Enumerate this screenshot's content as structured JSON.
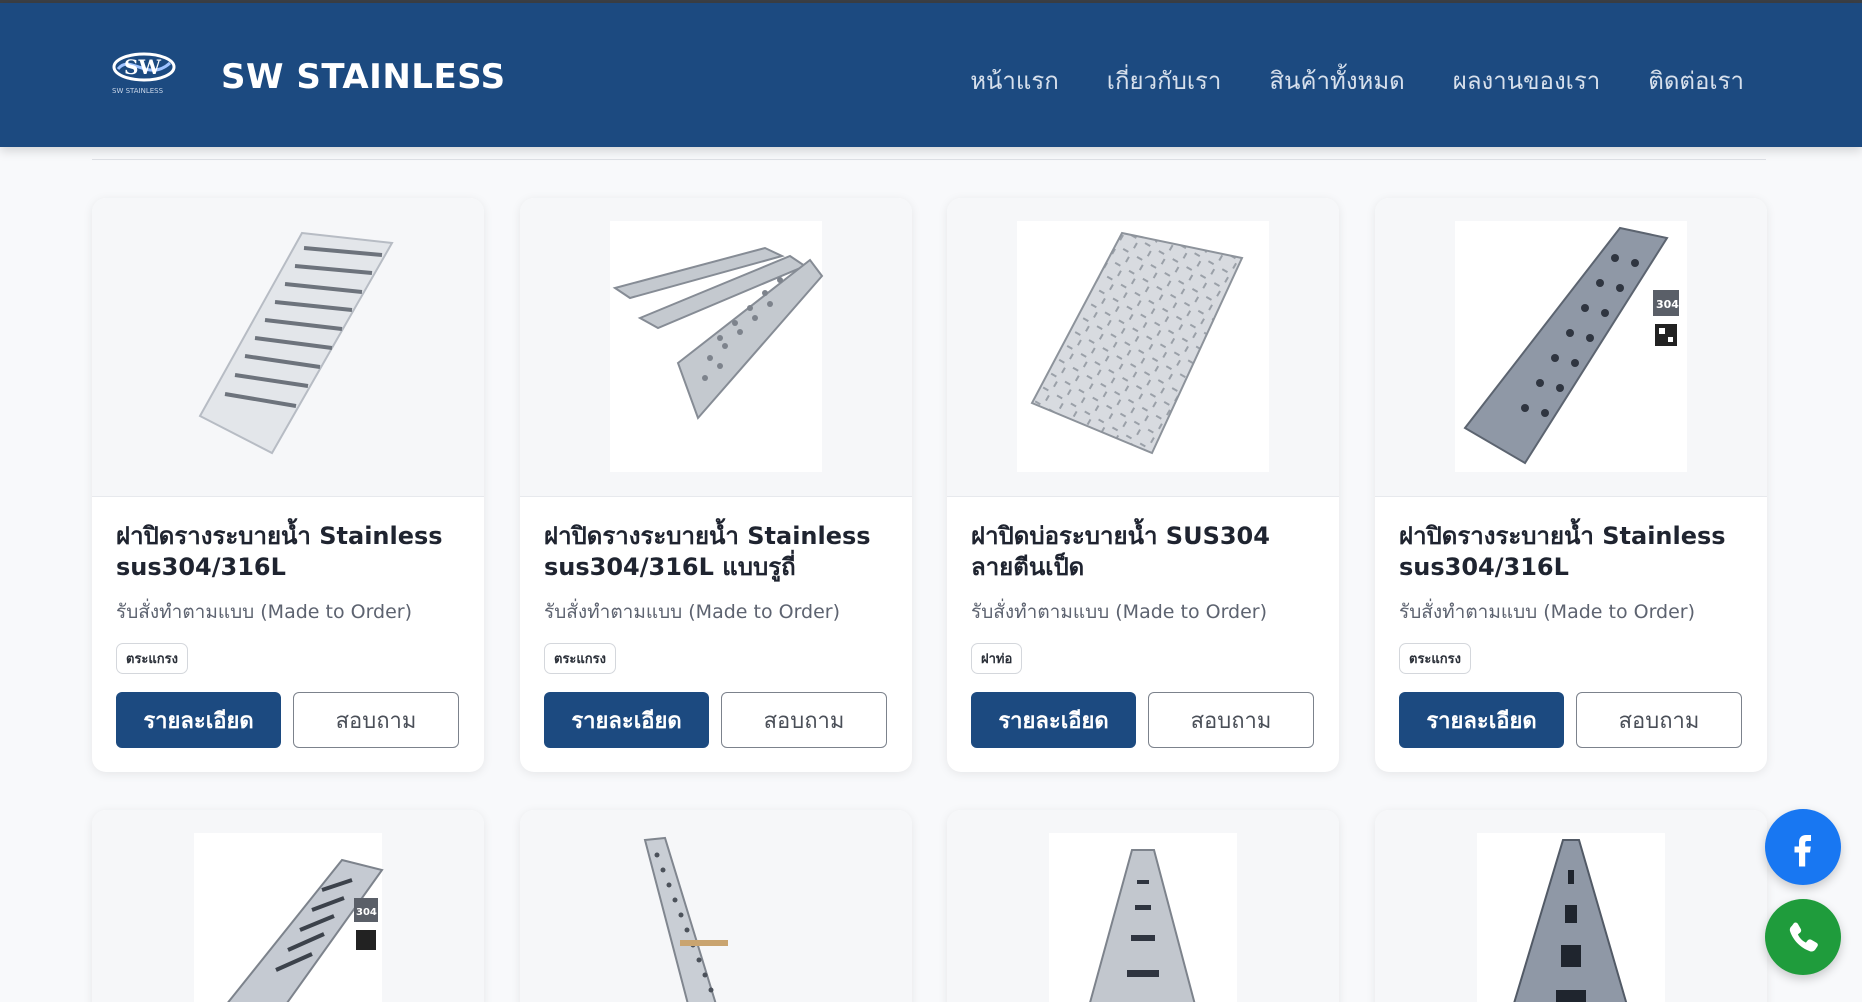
{
  "header": {
    "brand": "SW STAINLESS",
    "logo_text": "SW STAINLESS",
    "nav": [
      "หน้าแรก",
      "เกี่ยวกับเรา",
      "สินค้าทั้งหมด",
      "ผลงานของเรา",
      "ติดต่อเรา"
    ]
  },
  "products": [
    {
      "title": "ฝาปิดรางระบายน้ำ Stainless sus304/316L",
      "subtitle": "รับสั่งทำตามแบบ (Made to Order)",
      "tag": "ตระแกรง",
      "detail_label": "รายละเอียด",
      "inquire_label": "สอบถาม"
    },
    {
      "title": "ฝาปิดรางระบายน้ำ Stainless sus304/316L แบบรูถี่",
      "subtitle": "รับสั่งทำตามแบบ (Made to Order)",
      "tag": "ตระแกรง",
      "detail_label": "รายละเอียด",
      "inquire_label": "สอบถาม"
    },
    {
      "title": "ฝาปิดบ่อระบายน้ำ SUS304 ลายตีนเป็ด",
      "subtitle": "รับสั่งทำตามแบบ (Made to Order)",
      "tag": "ฝาท่อ",
      "detail_label": "รายละเอียด",
      "inquire_label": "สอบถาม"
    },
    {
      "title": "ฝาปิดรางระบายน้ำ Stainless sus304/316L",
      "subtitle": "รับสั่งทำตามแบบ (Made to Order)",
      "tag": "ตระแกรง",
      "detail_label": "รายละเอียด",
      "inquire_label": "สอบถาม"
    }
  ],
  "image_badge": "304",
  "colors": {
    "brand": "#1c4a80",
    "facebook": "#1877f2",
    "phone": "#1f9c3c"
  },
  "icons": {
    "facebook": "facebook-icon",
    "phone": "phone-icon"
  }
}
